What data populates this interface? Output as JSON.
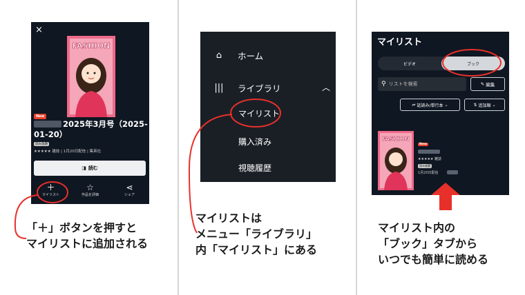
{
  "panel1": {
    "close": "×",
    "cover_text": "FASHION",
    "new_badge": "New",
    "title": "2025年3月号（2025-01-20）",
    "mini_badge": "読み放題",
    "meta": "★★★★★ 雑誌 | 1月20日配信 | 集英社",
    "read_button": "読む",
    "actions": [
      {
        "icon": "plus-icon",
        "glyph": "＋",
        "label": "マイリスト"
      },
      {
        "icon": "star-icon",
        "glyph": "☆",
        "label": "作品を評価"
      },
      {
        "icon": "share-icon",
        "glyph": "⋖",
        "label": "シェア"
      }
    ],
    "caption": [
      "「＋」ボタンを押すと",
      "マイリストに追加される"
    ]
  },
  "panel2": {
    "home": "ホーム",
    "library": "ライブラリ",
    "sub_items": [
      "マイリスト",
      "購入済み",
      "視聴履歴"
    ],
    "caption": [
      "マイリストは",
      "メニュー「ライブラリ」",
      "内「マイリスト」にある"
    ]
  },
  "panel3": {
    "title": "マイリスト",
    "tabs": [
      "ビデオ",
      "ブック"
    ],
    "active_tab": "ブック",
    "search_placeholder": "リストを検索",
    "edit_button": "編集",
    "sort1": "話読み/単行本",
    "sort2": "追加順",
    "cover_text": "FASHION",
    "new_badge": "New",
    "meta": "★★★★★ 雑誌",
    "mini_badge": "読み放題",
    "date": "1月20日配信",
    "caption": [
      "マイリスト内の",
      "「ブック」タブから",
      "いつでも簡単に読める"
    ]
  },
  "colors": {
    "accent": "#e8302a",
    "panel_bg": "#0f1722"
  }
}
